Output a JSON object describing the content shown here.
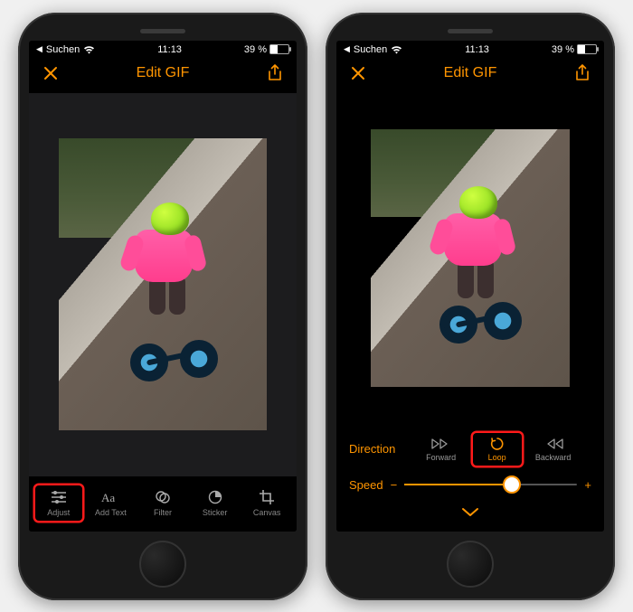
{
  "status_bar": {
    "back_label": "Suchen",
    "time": "11:13",
    "battery_text": "39 %"
  },
  "nav": {
    "title": "Edit GIF"
  },
  "toolbar": {
    "items": [
      {
        "id": "adjust",
        "label": "Adjust"
      },
      {
        "id": "add-text",
        "label": "Add Text"
      },
      {
        "id": "filter",
        "label": "Filter"
      },
      {
        "id": "sticker",
        "label": "Sticker"
      },
      {
        "id": "canvas",
        "label": "Canvas"
      }
    ],
    "highlighted": "adjust"
  },
  "direction": {
    "label": "Direction",
    "options": [
      {
        "id": "forward",
        "label": "Forward"
      },
      {
        "id": "loop",
        "label": "Loop"
      },
      {
        "id": "backward",
        "label": "Backward"
      }
    ],
    "selected": "loop",
    "highlighted": "loop"
  },
  "speed": {
    "label": "Speed",
    "minus": "−",
    "plus": "+",
    "value_percent": 62
  },
  "accent_color": "#ff9500",
  "highlight_color": "#ff1a1a"
}
